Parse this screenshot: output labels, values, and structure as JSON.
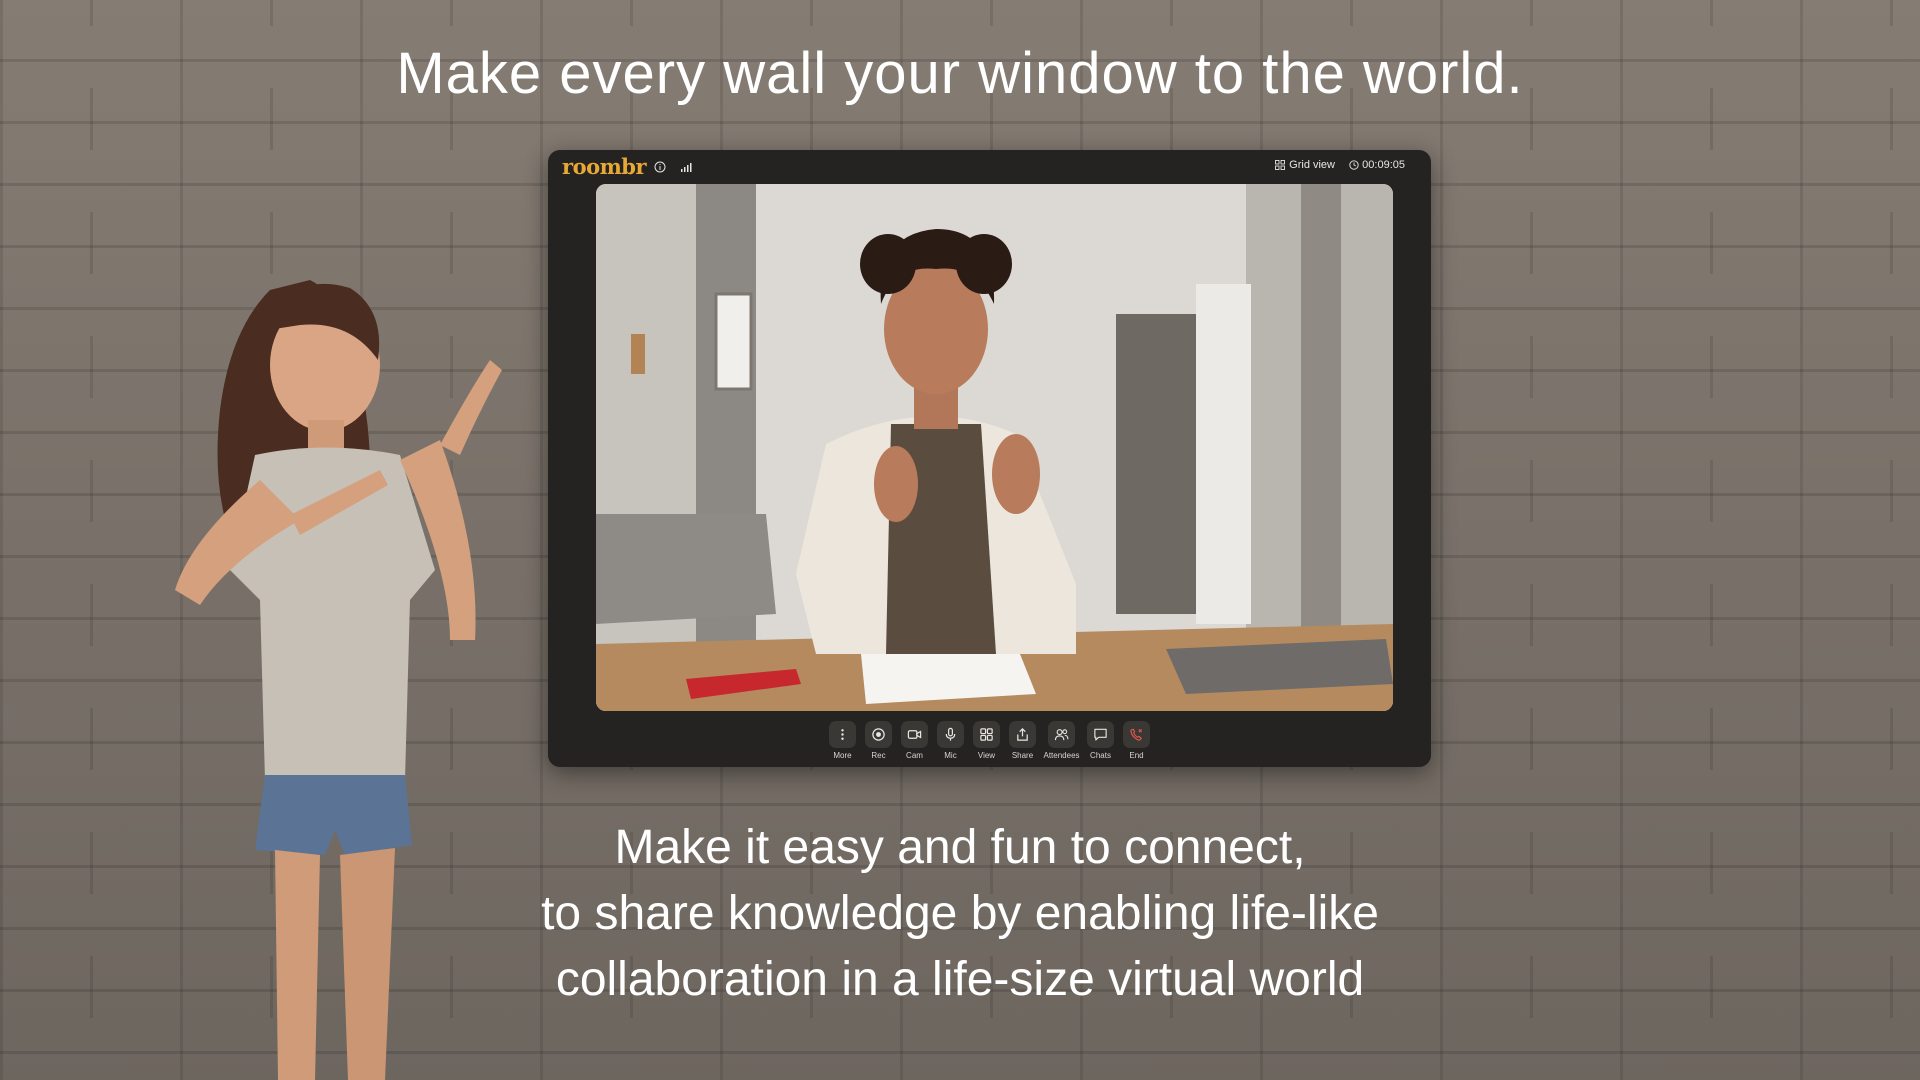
{
  "headline": "Make every wall your window to the world.",
  "tagline": [
    "Make it easy and fun to connect,",
    "to share knowledge by enabling life-like",
    "collaboration in a life-size virtual world"
  ],
  "app": {
    "logo": "roombr",
    "grid_view_label": "Grid view",
    "timer": "00:09:05",
    "accent_color": "#e8a836",
    "end_color": "#e2574c"
  },
  "controls": [
    {
      "label": "More",
      "icon": "more-vertical-icon"
    },
    {
      "label": "Rec",
      "icon": "record-icon"
    },
    {
      "label": "Cam",
      "icon": "camera-icon"
    },
    {
      "label": "Mic",
      "icon": "microphone-icon"
    },
    {
      "label": "View",
      "icon": "grid-icon"
    },
    {
      "label": "Share",
      "icon": "share-icon"
    },
    {
      "label": "Attendees",
      "icon": "attendees-icon"
    },
    {
      "label": "Chats",
      "icon": "chat-icon"
    },
    {
      "label": "End",
      "icon": "end-call-icon"
    }
  ]
}
